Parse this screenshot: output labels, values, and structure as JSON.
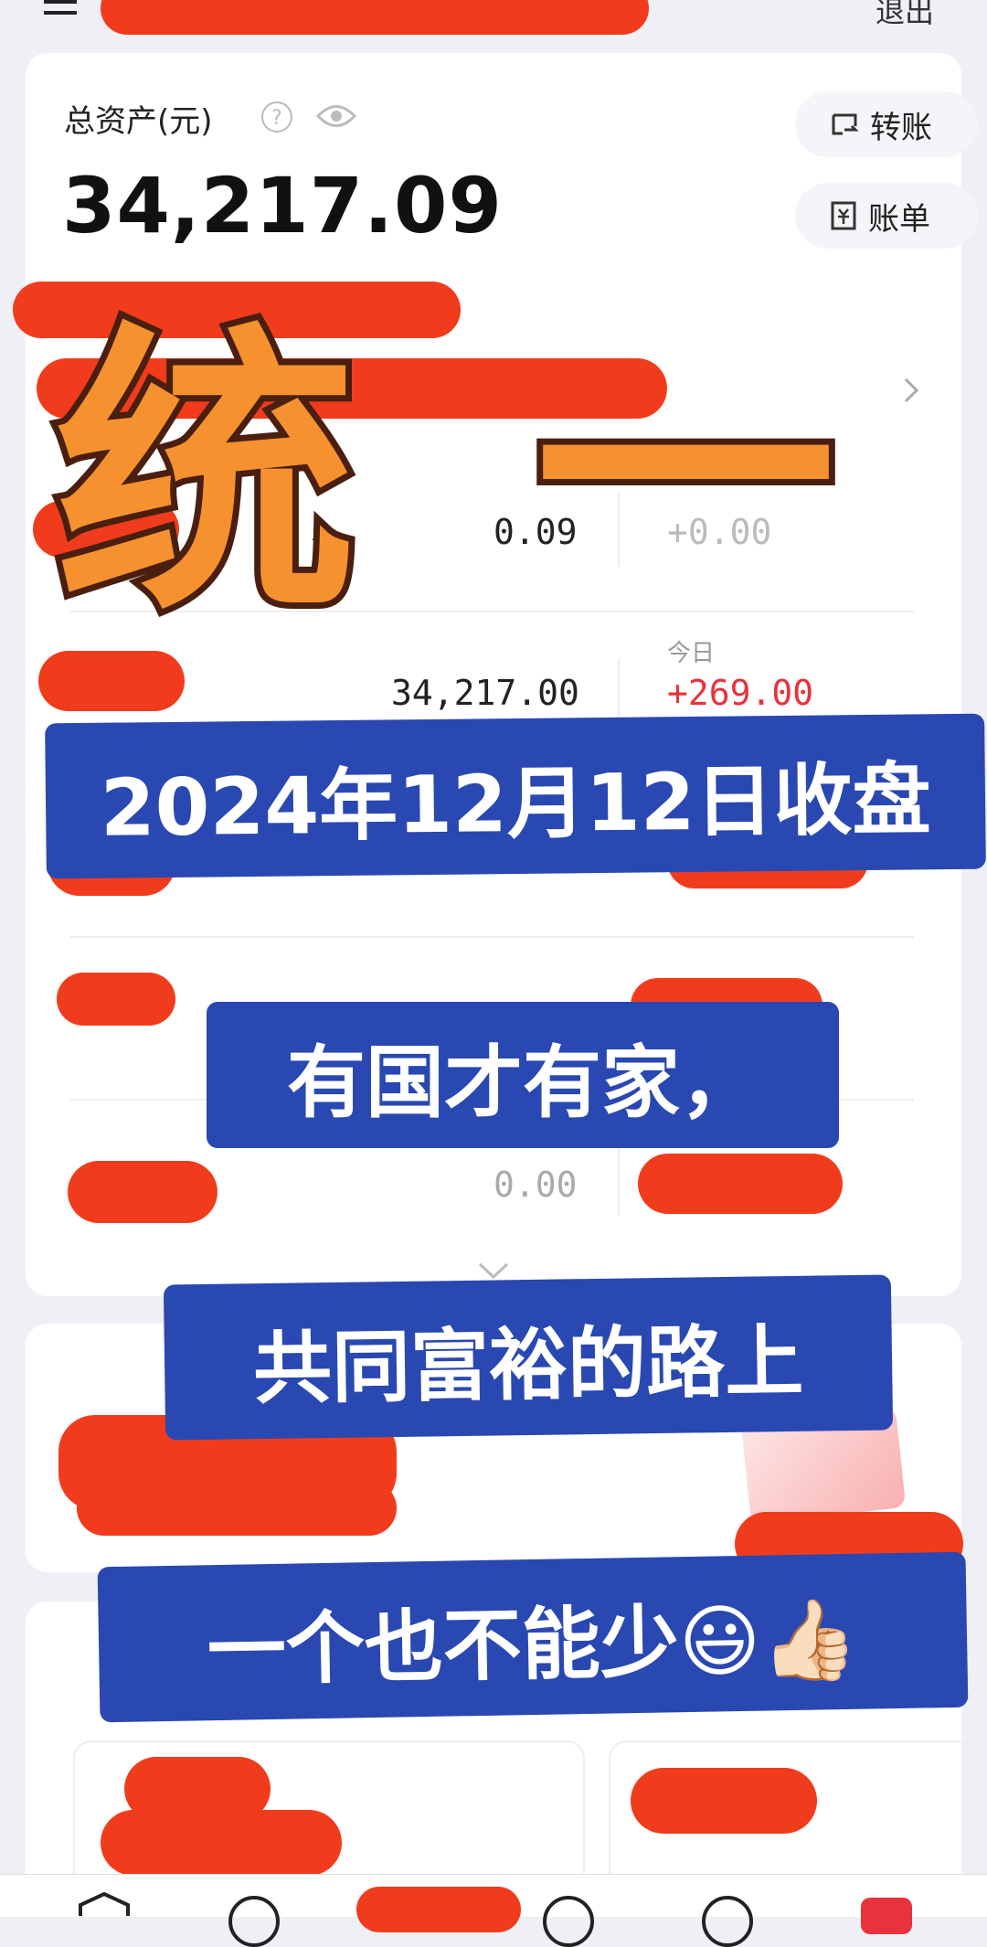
{
  "header": {
    "logout_label": "退出"
  },
  "assets": {
    "title": "总资产(元)",
    "total": "34,217.09",
    "transfer_label": "转账",
    "bill_label": "账单",
    "hint_label": "?"
  },
  "rows": [
    {
      "amount": "0.09",
      "change": "+0.00",
      "change_label": ""
    },
    {
      "amount": "34,217.00",
      "change": "+269.00",
      "change_label": "今日"
    },
    {
      "amount": "0.00",
      "change": "",
      "change_label": ""
    },
    {
      "amount": "0.00",
      "change": "",
      "change_label": ""
    }
  ],
  "overlay": {
    "big_title": "统 一",
    "banner1": "2024年12月12日收盘",
    "banner2": "有国才有家，",
    "banner3": "共同富裕的路上",
    "banner4": "一个也不能少😃👍🏻"
  },
  "colors": {
    "accent_red": "#e8323c",
    "redaction": "#f03c1c",
    "banner_blue": "#2a48b2",
    "title_orange": "#f5922f",
    "title_outline": "#4a1f10"
  },
  "icons": [
    "question-icon",
    "eye-icon",
    "transfer-icon",
    "bill-icon",
    "chevron-right-icon",
    "chevron-down-icon",
    "menu-icon"
  ]
}
